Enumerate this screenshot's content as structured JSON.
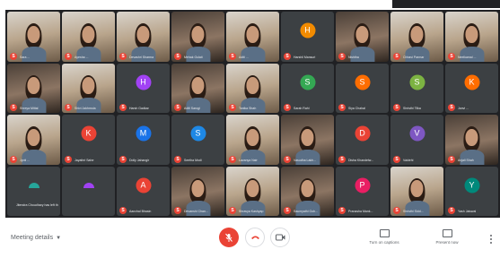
{
  "participants": [
    {
      "type": "video",
      "variant": "alt",
      "name": "Sara ..."
    },
    {
      "type": "video",
      "variant": "alt",
      "name": "Ayesha ..."
    },
    {
      "type": "video",
      "variant": "alt",
      "name": "Devashri Sharma"
    },
    {
      "type": "video",
      "variant": "dark",
      "name": "Mehak Gulati"
    },
    {
      "type": "video",
      "variant": "alt",
      "name": "Aditi ..."
    },
    {
      "type": "avatar",
      "initial": "H",
      "color": "#f28b00",
      "name": "Harshil Mansuri"
    },
    {
      "type": "video",
      "variant": "dark",
      "name": "Nishtha"
    },
    {
      "type": "video",
      "variant": "alt",
      "name": "Chhavi Parmar"
    },
    {
      "type": "video",
      "variant": "alt",
      "name": "Neelkamal ..."
    },
    {
      "type": "video",
      "variant": "dark",
      "name": "Shreya Mittal"
    },
    {
      "type": "video",
      "variant": "alt",
      "name": "Shivi Jakhmola"
    },
    {
      "type": "avatar",
      "initial": "H",
      "color": "#a142f4",
      "name": "Harsh Gadkar"
    },
    {
      "type": "video",
      "variant": "dark",
      "name": "Aditi Sarogi"
    },
    {
      "type": "video",
      "variant": "alt",
      "name": "Tanika Shah"
    },
    {
      "type": "avatar",
      "initial": "S",
      "color": "#34a853",
      "name": "Sarah Rahi"
    },
    {
      "type": "avatar",
      "initial": "S",
      "color": "#ff6d00",
      "name": "Siya Chahal"
    },
    {
      "type": "avatar",
      "initial": "S",
      "color": "#7cb342",
      "name": "Shristhi Tilka"
    },
    {
      "type": "avatar",
      "initial": "K",
      "color": "#ff6d00",
      "name": "Janvi ..."
    },
    {
      "type": "video",
      "variant": "alt",
      "name": "Jyoti ..."
    },
    {
      "type": "avatar",
      "initial": "K",
      "color": "#ea4335",
      "name": "Jayathri Sahe"
    },
    {
      "type": "avatar",
      "initial": "M",
      "color": "#1a73e8",
      "name": "Dolly Jahangir"
    },
    {
      "type": "avatar",
      "initial": "S",
      "color": "#1e88e5",
      "name": "Seetha Modi"
    },
    {
      "type": "video",
      "variant": "alt",
      "name": "Lavanya Nair"
    },
    {
      "type": "video",
      "variant": "dark",
      "name": "Vasudha Lakh..."
    },
    {
      "type": "avatar",
      "initial": "D",
      "color": "#ea4335",
      "name": "Disha Khandelw..."
    },
    {
      "type": "avatar",
      "initial": "V",
      "color": "#7e57c2",
      "name": "Vaidehi"
    },
    {
      "type": "video",
      "variant": "dark",
      "name": "Anjali Shah"
    },
    {
      "type": "notice",
      "text": "Jitendra Choudhary has left the meeting"
    },
    {
      "type": "notice",
      "text": ""
    },
    {
      "type": "avatar",
      "initial": "A",
      "color": "#ea4335",
      "name": "Aanchal Bhasin"
    },
    {
      "type": "video",
      "variant": "dark",
      "name": "Devanshi Chan..."
    },
    {
      "type": "video",
      "variant": "alt",
      "name": "Shravya Kashyap"
    },
    {
      "type": "video",
      "variant": "dark",
      "name": "Saumyathi Goh..."
    },
    {
      "type": "avatar",
      "initial": "P",
      "color": "#e91e63",
      "name": "Pranasha Mank..."
    },
    {
      "type": "video",
      "variant": "alt",
      "name": "Shristhi Sidd..."
    },
    {
      "type": "avatar",
      "initial": "Y",
      "color": "#00897b",
      "name": "Yash Jaiswal"
    }
  ],
  "controls": {
    "meeting_details_label": "Meeting details",
    "captions_label": "Turn on captions",
    "present_label": "Present now"
  },
  "colors": {
    "grid_background": "#202124",
    "mic_muted": "#ea4335",
    "hangup": "#ea4335",
    "icon_gray": "#5f6368"
  }
}
